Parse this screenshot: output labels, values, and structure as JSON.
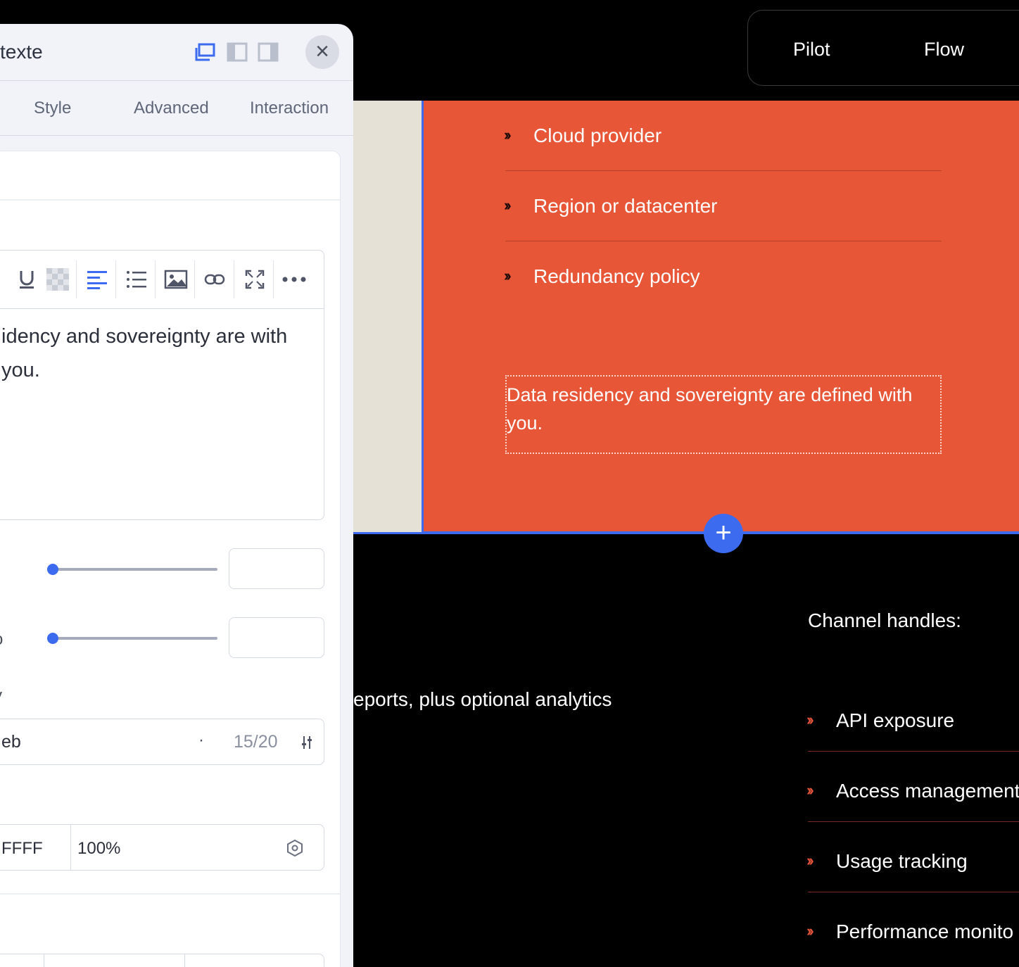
{
  "nav": {
    "items": [
      "Pilot",
      "Flow"
    ]
  },
  "orange_section": {
    "list": [
      "Cloud provider",
      "Region or datacenter",
      "Redundancy policy"
    ],
    "selected_text": "Data residency and sovereignty are defined with you."
  },
  "dark_section": {
    "channel_title": "Channel handles:",
    "reports_text": "eports, plus optional analytics",
    "list": [
      "API exposure",
      "Access management",
      "Usage tracking",
      "Performance monito"
    ]
  },
  "panel": {
    "title": "texte",
    "tabs": [
      "Style",
      "Advanced",
      "Interaction"
    ],
    "editor_text": "idency and sovereignty are with you.",
    "label_partial_1": "o",
    "label_partial_2": "y",
    "font_value": "eb",
    "font_dot": "·",
    "font_weight_counter": "15/20",
    "color_hex": "FFFF",
    "color_opacity": "100%"
  },
  "colors": {
    "accent": "#3d6bf0",
    "orange": "#e85638",
    "beige": "#e6e1d7",
    "chevron_dark": "#1b0a06",
    "chevron_red": "#e2543a"
  }
}
